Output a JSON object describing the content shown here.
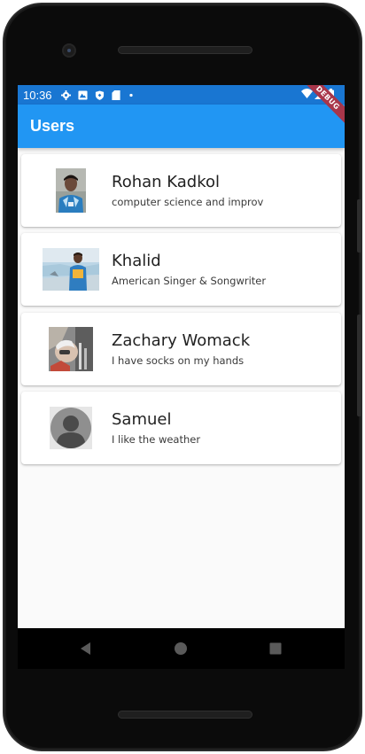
{
  "status_bar": {
    "time": "10:36",
    "icons": [
      "settings-icon",
      "image-icon",
      "shield-icon",
      "sd-card-icon",
      "dot-icon"
    ],
    "right_icons": [
      "wifi-icon",
      "signal-icon",
      "battery-icon"
    ],
    "color": "#1976d2"
  },
  "debug_banner": "DEBUG",
  "app_bar": {
    "title": "Users",
    "color": "#2196f3"
  },
  "users": [
    {
      "name": "Rohan Kadkol",
      "bio": "computer science and improv",
      "avatar": "photo-avatar"
    },
    {
      "name": "Khalid",
      "bio": "American Singer & Songwriter",
      "avatar": "photo-avatar"
    },
    {
      "name": "Zachary Womack",
      "bio": "I have socks on my hands",
      "avatar": "photo-avatar"
    },
    {
      "name": "Samuel",
      "bio": "I like the weather",
      "avatar": "default-avatar-icon"
    }
  ],
  "nav": {
    "back": "back-icon",
    "home": "home-icon",
    "recents": "recents-icon"
  }
}
